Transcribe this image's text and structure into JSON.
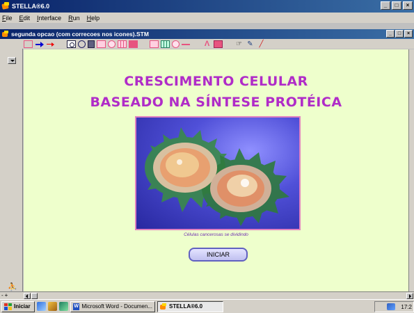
{
  "app": {
    "title": "STELLA®6.0",
    "controls": [
      "_",
      "□",
      "×"
    ]
  },
  "menu": {
    "items": [
      "File",
      "Edit",
      "Interface",
      "Run",
      "Help"
    ]
  },
  "document": {
    "title": "segunda opcao (com correcoes nos icones).STM",
    "controls": [
      "_",
      "□",
      "×"
    ]
  },
  "toolbar": {
    "tools": [
      "navigate-icon",
      "flow-arrow-icon",
      "connector-arrow-icon",
      "module-icon",
      "converter-icon",
      "stock-icon",
      "decision-icon",
      "button-icon",
      "sector-icon",
      "text-icon",
      "graph-icon",
      "table-icon",
      "numeric-display-icon",
      "slider-icon",
      "lambda-icon",
      "loop-pad-icon",
      "hand-icon",
      "paintbrush-icon",
      "dynamite-icon"
    ]
  },
  "canvas": {
    "background": "#eeffcc",
    "heading_line1": "CRESCIMENTO CELULAR",
    "heading_line2": "BASEADO NA SÍNTESE PROTÉICA",
    "heading_color": "#b02cc8",
    "image_caption": "Células cancerosas se dividindo",
    "button_label": "INICIAR"
  },
  "scroll": {
    "zoom_label": "-+"
  },
  "taskbar": {
    "start_label": "Iniciar",
    "tasks": [
      {
        "label": "Microsoft Word - Documen...",
        "active": false
      },
      {
        "label": "STELLA®6.0",
        "active": true
      }
    ],
    "clock": "17:2"
  }
}
